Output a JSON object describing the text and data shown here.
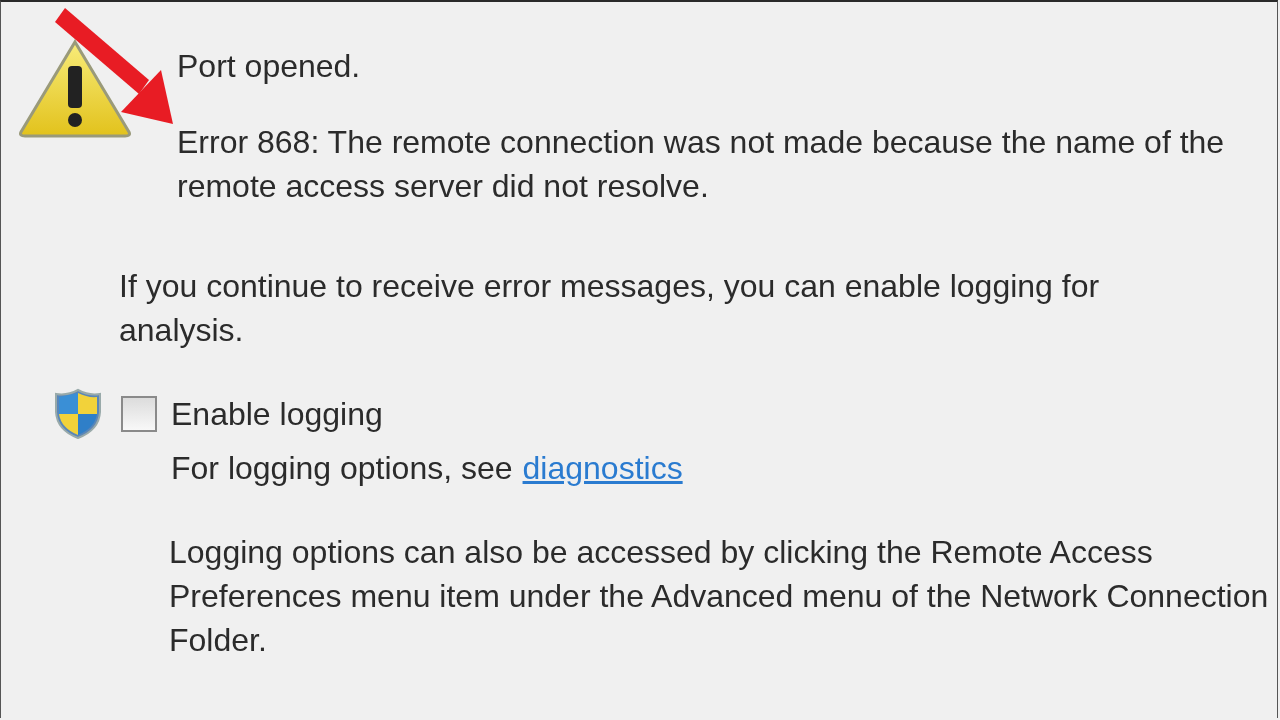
{
  "dialog": {
    "status": "Port opened.",
    "error_message": "Error 868: The remote connection was not made because the name of the remote access server did not resolve.",
    "advice": "If you continue to receive error messages, you can enable logging for analysis.",
    "enable_logging": {
      "label": "Enable logging",
      "checked": false
    },
    "logging_hint": "For logging options, see",
    "diagnostics_link": "diagnostics",
    "logging_note": "Logging options can also be accessed by clicking the Remote Access Preferences menu item under the Advanced menu of the Network Connection Folder."
  }
}
